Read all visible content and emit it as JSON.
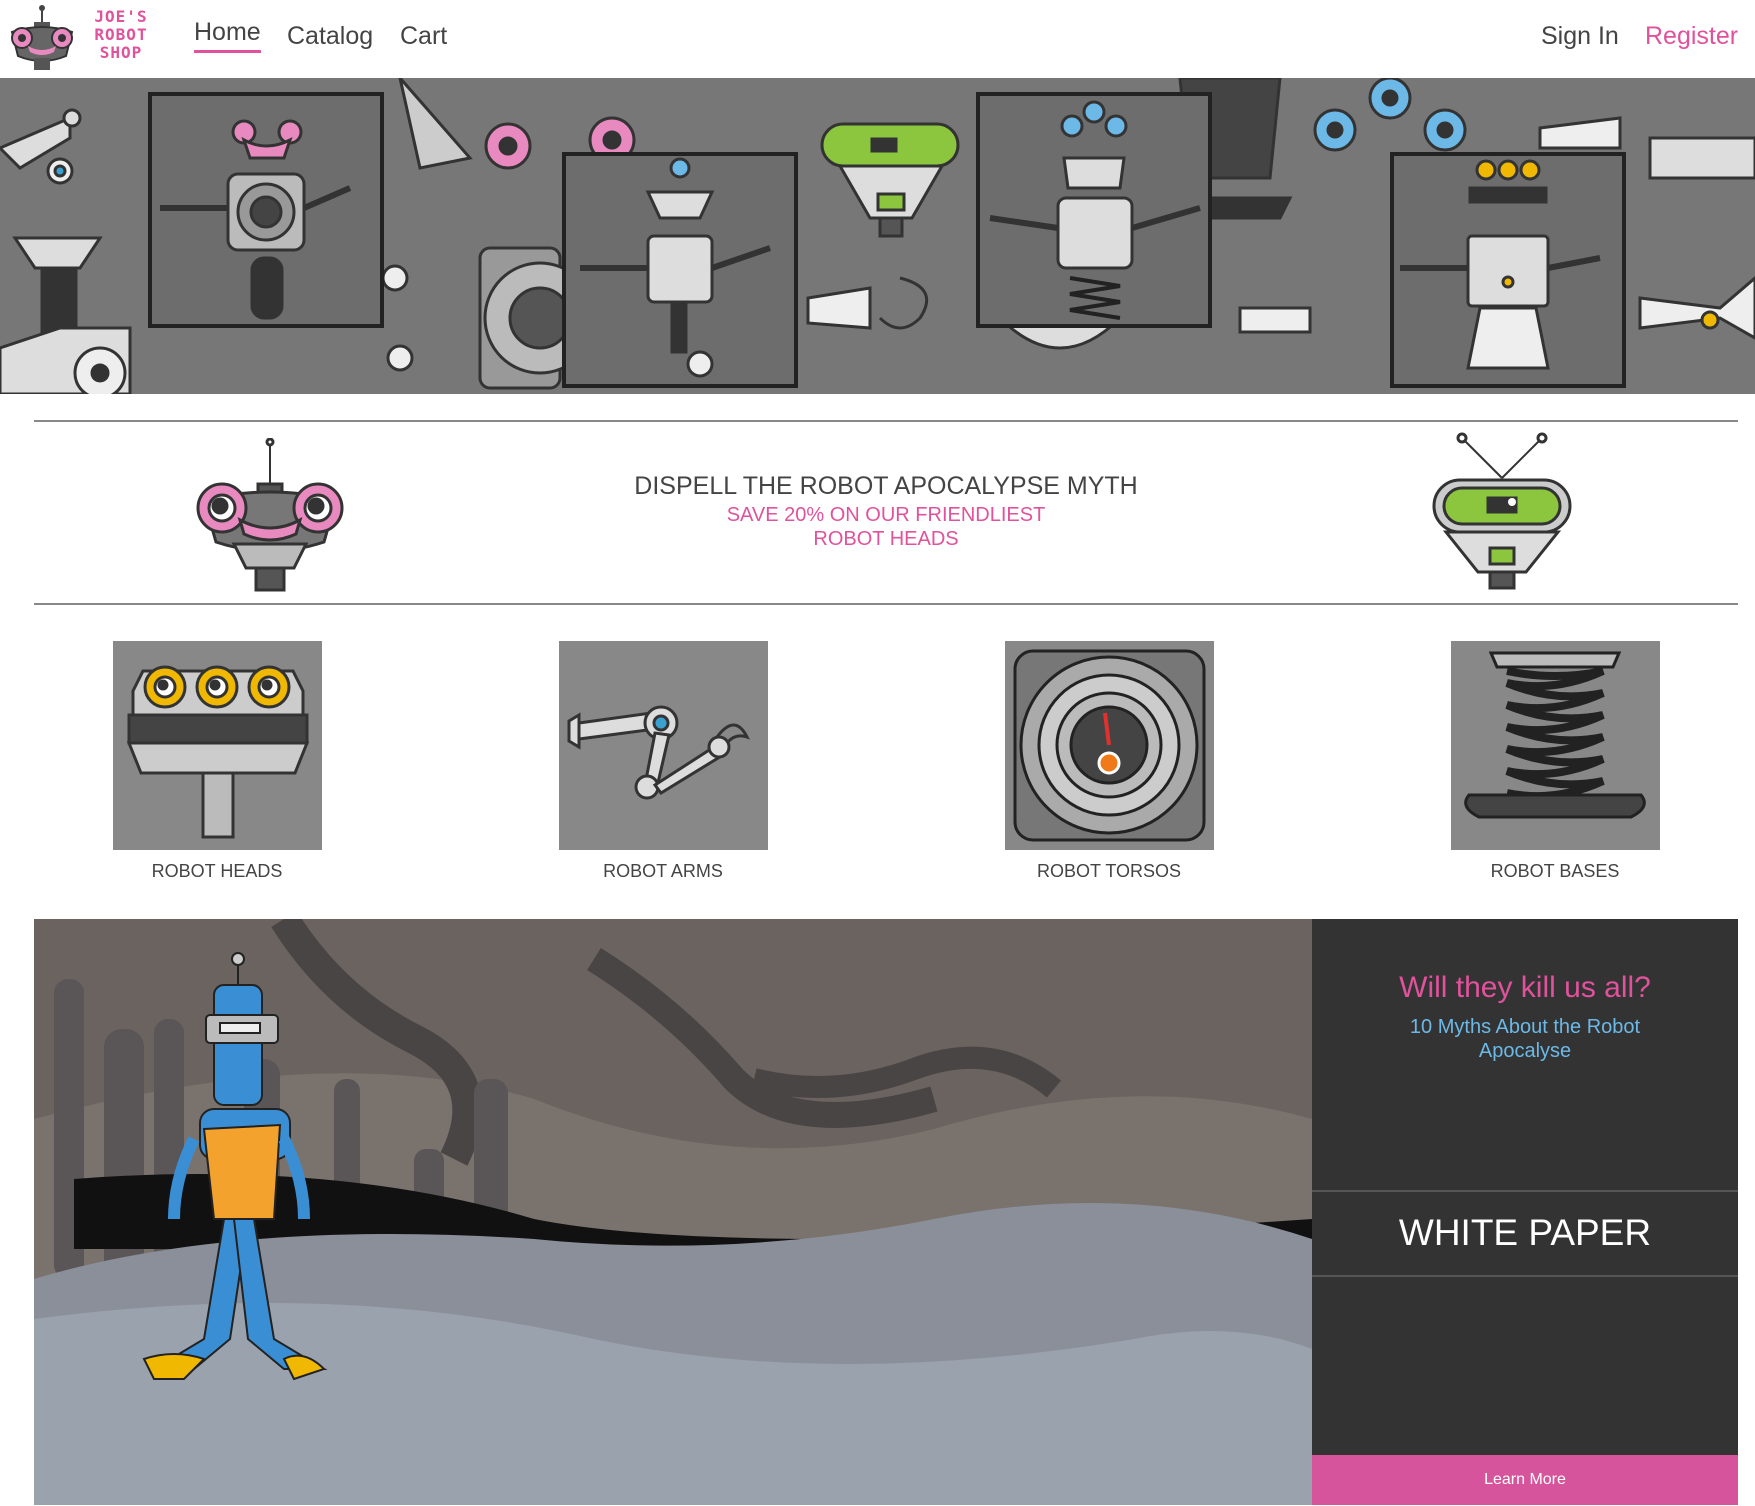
{
  "nav": {
    "logo_lines": [
      "JOE'S",
      "ROBOT",
      "SHOP"
    ],
    "links": [
      "Home",
      "Catalog",
      "Cart"
    ],
    "active": "Home",
    "signin": "Sign In",
    "register": "Register"
  },
  "promo": {
    "title": "DISPELL THE ROBOT APOCALYPSE MYTH",
    "subtitle": "SAVE 20% ON OUR FRIENDLIEST ROBOT HEADS"
  },
  "categories": [
    {
      "label": "ROBOT HEADS"
    },
    {
      "label": "ROBOT ARMS"
    },
    {
      "label": "ROBOT TORSOS"
    },
    {
      "label": "ROBOT BASES"
    }
  ],
  "feature": {
    "question": "Will they kill us all?",
    "subtitle": "10 Myths About the Robot Apocalyse",
    "heading": "WHITE PAPER",
    "button": "Learn More"
  },
  "colors": {
    "accent": "#e0529b",
    "blue": "#6cb9e8",
    "dark": "#333333"
  }
}
